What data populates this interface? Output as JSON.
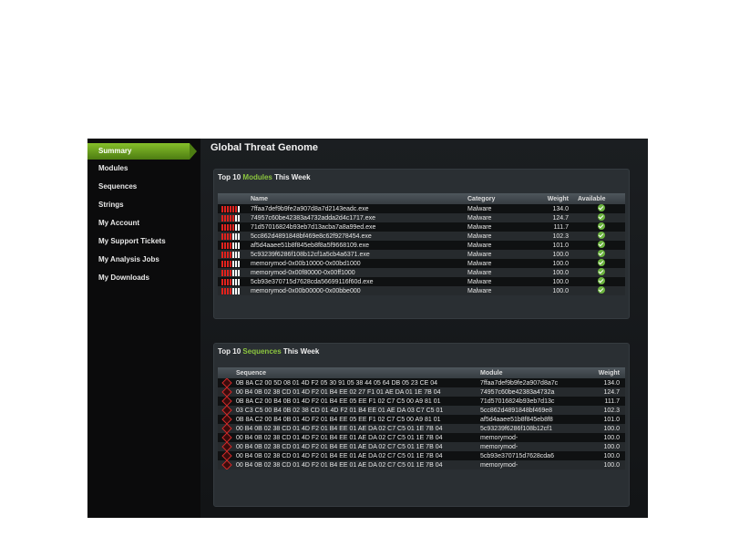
{
  "sidebar": {
    "items": [
      {
        "label": "Summary",
        "active": true
      },
      {
        "label": "Modules"
      },
      {
        "label": "Sequences"
      },
      {
        "label": "Strings"
      },
      {
        "label": "My Account"
      },
      {
        "label": "My Support Tickets"
      },
      {
        "label": "My Analysis Jobs"
      },
      {
        "label": "My Downloads"
      }
    ]
  },
  "main": {
    "title": "Global Threat Genome",
    "modules_panel": {
      "title_prefix": "Top 10 ",
      "title_accent": "Modules",
      "title_suffix": " This Week",
      "columns": {
        "name": "Name",
        "category": "Category",
        "weight": "Weight",
        "available": "Available"
      },
      "rows": [
        {
          "name": "7ffaa7def9b9fe2a907d8a7d2143eadc.exe",
          "category": "Malware",
          "weight": "134.0",
          "red_bars": 6
        },
        {
          "name": "74957c60be42383a4732adda2d4c1717.exe",
          "category": "Malware",
          "weight": "124.7",
          "red_bars": 5
        },
        {
          "name": "71d57016824b93eb7d13acba7a8a99ed.exe",
          "category": "Malware",
          "weight": "111.7",
          "red_bars": 5
        },
        {
          "name": "5cc862d4891848bf469e8c62f9278454.exe",
          "category": "Malware",
          "weight": "102.3",
          "red_bars": 4
        },
        {
          "name": "af5d4aaee51b8f845eb8f8a5f9668109.exe",
          "category": "Malware",
          "weight": "101.0",
          "red_bars": 4
        },
        {
          "name": "5c93239f6286f108b12cf1a5cb4a6371.exe",
          "category": "Malware",
          "weight": "100.0",
          "red_bars": 4
        },
        {
          "name": "memorymod-0x00b10000-0x00bd1000",
          "category": "Malware",
          "weight": "100.0",
          "red_bars": 4
        },
        {
          "name": "memorymod-0x00f80000-0x00ff1000",
          "category": "Malware",
          "weight": "100.0",
          "red_bars": 4
        },
        {
          "name": "5cb93e370715d7628cda56699116f60d.exe",
          "category": "Malware",
          "weight": "100.0",
          "red_bars": 4
        },
        {
          "name": "memorymod-0x00b00000-0x00bbe000",
          "category": "Malware",
          "weight": "100.0",
          "red_bars": 4
        }
      ]
    },
    "sequences_panel": {
      "title_prefix": "Top 10 ",
      "title_accent": "Sequences",
      "title_suffix": " This Week",
      "columns": {
        "sequence": "Sequence",
        "module": "Module",
        "weight": "Weight"
      },
      "rows": [
        {
          "sequence": "0B 8A C2 00 5D 08 01 4D F2 05 30 91 05 38 44 05 64 DB 05 23 CE 04",
          "module": "7ffaa7def9b9fe2a907d8a7c",
          "weight": "134.0"
        },
        {
          "sequence": "00 B4 0B 02 38 CD 01 4D F2 01 B4 EE 02 27 F1 01 AE DA 01 1E 7B 04",
          "module": "74957c60be42383a4732a",
          "weight": "124.7"
        },
        {
          "sequence": "0B 8A C2 00 B4 0B 01 4D F2 01 B4 EE 05 EE F1 02 C7 C5 00 A9 81 01",
          "module": "71d57016824b93eb7d13c",
          "weight": "111.7"
        },
        {
          "sequence": "03 C3 C5 00 B4 0B 02 38 CD 01 4D F2 01 B4 EE 01 AE DA 03 C7 C5 01",
          "module": "5cc862d4891848bf469e8",
          "weight": "102.3"
        },
        {
          "sequence": "0B 8A C2 00 B4 0B 01 4D F2 01 B4 EE 05 EE F1 02 C7 C5 00 A9 81 01",
          "module": "af5d4aaee51b8f845eb8f8",
          "weight": "101.0"
        },
        {
          "sequence": "00 B4 0B 02 38 CD 01 4D F2 01 B4 EE 01 AE DA 02 C7 C5 01 1E 7B 04",
          "module": "5c93239f6286f108b12cf1",
          "weight": "100.0"
        },
        {
          "sequence": "00 B4 0B 02 38 CD 01 4D F2 01 B4 EE 01 AE DA 02 C7 C5 01 1E 7B 04",
          "module": "memorymod-",
          "weight": "100.0"
        },
        {
          "sequence": "00 B4 0B 02 38 CD 01 4D F2 01 B4 EE 01 AE DA 02 C7 C5 01 1E 7B 04",
          "module": "memorymod-",
          "weight": "100.0"
        },
        {
          "sequence": "00 B4 0B 02 38 CD 01 4D F2 01 B4 EE 01 AE DA 02 C7 C5 01 1E 7B 04",
          "module": "5cb93e370715d7628cda6",
          "weight": "100.0"
        },
        {
          "sequence": "00 B4 0B 02 38 CD 01 4D F2 01 B4 EE 01 AE DA 02 C7 C5 01 1E 7B 04",
          "module": "memorymod-",
          "weight": "100.0"
        }
      ]
    }
  },
  "colors": {
    "accent": "#8cc63f",
    "threat_red": "#e0221d",
    "available_green": "#6cb33f"
  },
  "icons": {
    "available": "check-circle-icon",
    "sequence": "sequence-gene-icon",
    "threat_meter": "threat-meter-icon"
  }
}
